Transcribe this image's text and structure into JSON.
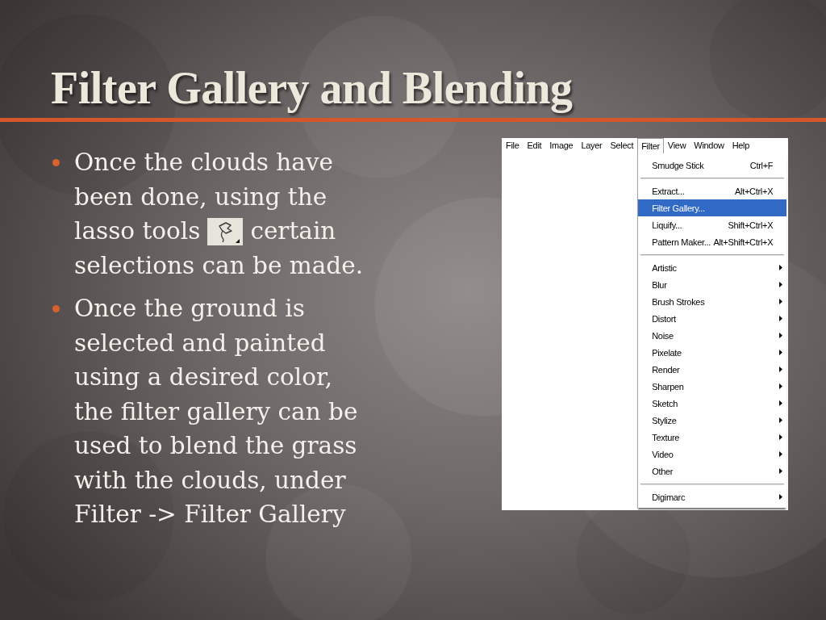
{
  "title": "Filter Gallery and Blending",
  "bullets": [
    {
      "parts": [
        {
          "kind": "text",
          "text": "Once the clouds have been done, using the lasso tools"
        },
        {
          "kind": "tool_icon"
        },
        {
          "kind": "text",
          "text": "certain selections can be made."
        }
      ]
    },
    {
      "parts": [
        {
          "kind": "text",
          "text": "Once the ground is selected and painted using a desired color, the filter gallery can be used to blend the grass with the clouds, under Filter -> Filter Gallery"
        }
      ]
    }
  ],
  "screenshot": {
    "menu_bar": [
      {
        "label": "File",
        "selected": false
      },
      {
        "label": "Edit",
        "selected": false
      },
      {
        "label": "Image",
        "selected": false
      },
      {
        "label": "Layer",
        "selected": false
      },
      {
        "label": "Select",
        "selected": false
      },
      {
        "label": "Filter",
        "selected": true
      },
      {
        "label": "View",
        "selected": false
      },
      {
        "label": "Window",
        "selected": false
      },
      {
        "label": "Help",
        "selected": false
      }
    ],
    "menu": {
      "items": [
        {
          "kind": "command",
          "label": "Smudge Stick",
          "shortcut": "Ctrl+F",
          "selected": false
        },
        {
          "kind": "separator"
        },
        {
          "kind": "command",
          "label": "Extract...",
          "shortcut": "Alt+Ctrl+X",
          "selected": false
        },
        {
          "kind": "command",
          "label": "Filter Gallery...",
          "selected": true
        },
        {
          "kind": "command",
          "label": "Liquify...",
          "shortcut": "Shift+Ctrl+X",
          "selected": false
        },
        {
          "kind": "command",
          "label": "Pattern Maker...",
          "shortcut": "Alt+Shift+Ctrl+X",
          "selected": false
        },
        {
          "kind": "separator"
        },
        {
          "kind": "submenu",
          "label": "Artistic",
          "selected": false
        },
        {
          "kind": "submenu",
          "label": "Blur",
          "selected": false
        },
        {
          "kind": "submenu",
          "label": "Brush Strokes",
          "selected": false
        },
        {
          "kind": "submenu",
          "label": "Distort",
          "selected": false
        },
        {
          "kind": "submenu",
          "label": "Noise",
          "selected": false
        },
        {
          "kind": "submenu",
          "label": "Pixelate",
          "selected": false
        },
        {
          "kind": "submenu",
          "label": "Render",
          "selected": false
        },
        {
          "kind": "submenu",
          "label": "Sharpen",
          "selected": false
        },
        {
          "kind": "submenu",
          "label": "Sketch",
          "selected": false
        },
        {
          "kind": "submenu",
          "label": "Stylize",
          "selected": false
        },
        {
          "kind": "submenu",
          "label": "Texture",
          "selected": false
        },
        {
          "kind": "submenu",
          "label": "Video",
          "selected": false
        },
        {
          "kind": "submenu",
          "label": "Other",
          "selected": false
        },
        {
          "kind": "separator"
        },
        {
          "kind": "submenu",
          "label": "Digimarc",
          "selected": false
        }
      ]
    }
  }
}
